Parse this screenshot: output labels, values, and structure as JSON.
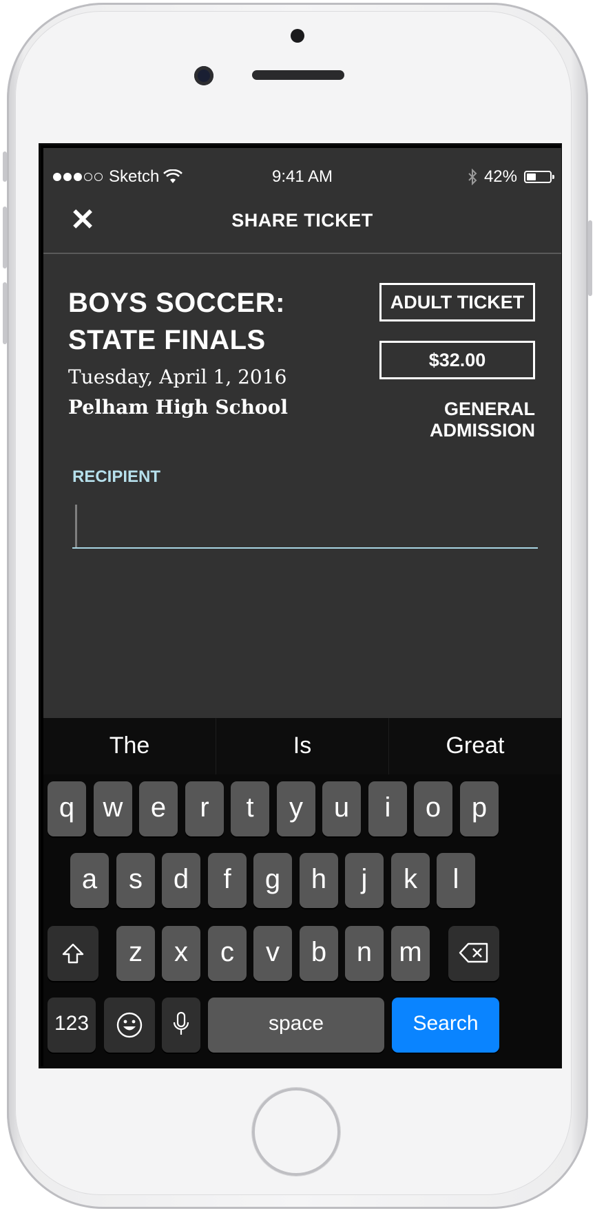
{
  "status_bar": {
    "carrier": "Sketch",
    "time": "9:41 AM",
    "battery": "42%",
    "battery_level": 0.42
  },
  "nav": {
    "close_icon": "close-icon",
    "title": "SHARE TICKET"
  },
  "event": {
    "title": "BOYS SOCCER: STATE FINALS",
    "date": "Tuesday, April 1, 2016",
    "venue": "Pelham High School"
  },
  "ticket": {
    "type": "ADULT TICKET",
    "price": "$32.00",
    "admission": "GENERAL ADMISSION"
  },
  "recipient": {
    "label": "RECIPIENT",
    "value": ""
  },
  "keyboard": {
    "predictions": [
      "The",
      "Is",
      "Great"
    ],
    "row1": [
      "q",
      "w",
      "e",
      "r",
      "t",
      "y",
      "u",
      "i",
      "o",
      "p"
    ],
    "row2": [
      "a",
      "s",
      "d",
      "f",
      "g",
      "h",
      "j",
      "k",
      "l"
    ],
    "row3": [
      "z",
      "x",
      "c",
      "v",
      "b",
      "n",
      "m"
    ],
    "numbers_key": "123",
    "space_key": "space",
    "action_key": "Search",
    "colors": {
      "action": "#0a84ff",
      "key": "#575757",
      "dark_key": "#2f2f2f"
    }
  },
  "colors": {
    "app_background": "#323232",
    "accent": "#b6e0ec"
  }
}
